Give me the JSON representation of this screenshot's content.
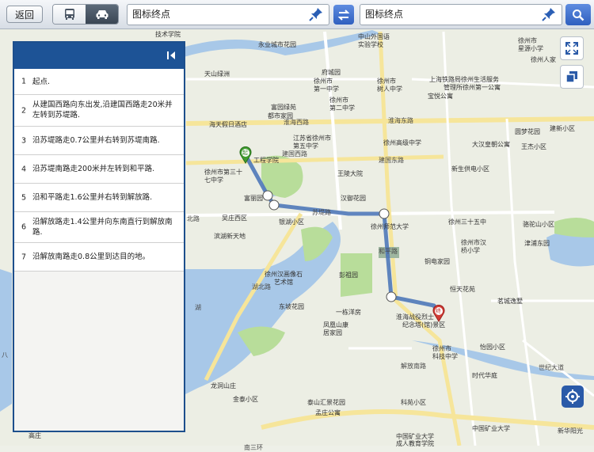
{
  "topbar": {
    "back_label": "返回",
    "start_field": "图标终点",
    "end_field": "图标终点"
  },
  "route_steps": [
    {
      "num": "1",
      "text": "起点."
    },
    {
      "num": "2",
      "text": "从建国西路向东出发,沿建国西路走20米并左转到苏堤路."
    },
    {
      "num": "3",
      "text": "沿苏堤路走0.7公里并右转到苏堤南路."
    },
    {
      "num": "4",
      "text": "沿苏堤南路走200米并左转到和平路."
    },
    {
      "num": "5",
      "text": "沿和平路走1.6公里并右转到解放路."
    },
    {
      "num": "6",
      "text": "沿解放路走1.4公里并向东南直行到解放南路."
    },
    {
      "num": "7",
      "text": "沿解放南路走0.8公里到达目的地。"
    }
  ],
  "map": {
    "start_marker": "起",
    "end_marker": "终",
    "labels": {
      "l1": "技术学院",
      "l2": "中山外国语",
      "l3": "实验学校",
      "l4": "徐州市",
      "l5": "星源小学",
      "l6": "永业城市花园",
      "l7": "徐州人家",
      "l8": "天山绿洲",
      "l9": "府城园",
      "l10": "徐州市",
      "l11": "第一中学",
      "l12": "徐州市",
      "l13": "树人中学",
      "l14": "上海铁路局徐州生活服务",
      "l15": "管理所徐州第一公寓",
      "l16": "富园绿苑",
      "l17": "徐州市",
      "l18": "第二中学",
      "l19": "宝悦公寓",
      "l20": "都市家园",
      "l21": "海天假日酒店",
      "l22": "圆梦花园",
      "l23": "建新小区",
      "l24": "江苏省徐州市",
      "l25": "第五中学",
      "l26": "徐州高级中学",
      "l27": "大汉皇朝公寓",
      "l28": "王杰小区",
      "l29": "工程学院",
      "l30": "徐州市第三十",
      "l31": "七中学",
      "l32": "王陵大院",
      "l33": "新生供电小区",
      "l34": "富丽园",
      "l35": "汉御花园",
      "l36": "银湖小区",
      "l37": "吴庄西区",
      "l38": "徐州三十五中",
      "l39": "骆驼山小区",
      "l40": "徐州师范大学",
      "l41": "滨湖新天地",
      "l42": "徐州市汉",
      "l43": "桥小学",
      "l44": "津浦东园",
      "l45": "铜电家园",
      "l46": "彭祖园",
      "l47": "徐州汉画像石",
      "l48": "艺术馆",
      "l49": "恒天花苑",
      "l50": "茗城逸墅",
      "l51": "东坡花园",
      "l52": "一栋洋房",
      "l53": "淮海战役烈士",
      "l54": "纪念塔(馆)景区",
      "l55": "凤凰山康",
      "l56": "居家园",
      "l57": "徐州市",
      "l58": "科技中学",
      "l59": "怡园小区",
      "l60": "时代华庭",
      "l61": "龙洞山庄",
      "l62": "金泰小区",
      "l63": "泰山汇景花园",
      "l64": "科苑小区",
      "l65": "孟庄公寓",
      "l66": "中国矿业大学",
      "l67": "中国矿业大学",
      "l68": "成人教育学院",
      "l69": "新华阳光",
      "l70": "高庄",
      "l71": "徐州市",
      "l72": "第一中学"
    },
    "roads": {
      "r1": "淮海西路",
      "r2": "淮海东路",
      "r3": "建国西路",
      "r4": "建国东路",
      "r5": "和平路",
      "r6": "北路",
      "r7": "解放南路",
      "r8": "苏堤路",
      "r9": "湖北路",
      "r10": "世纪大道",
      "r11": "南三环",
      "r12": "八",
      "r13": "湖",
      "r14": "解放南路"
    }
  },
  "colors": {
    "header_blue": "#1d5396",
    "route_blue": "#4f78b8",
    "water": "#a8c8e8",
    "park": "#b8dd9a"
  }
}
